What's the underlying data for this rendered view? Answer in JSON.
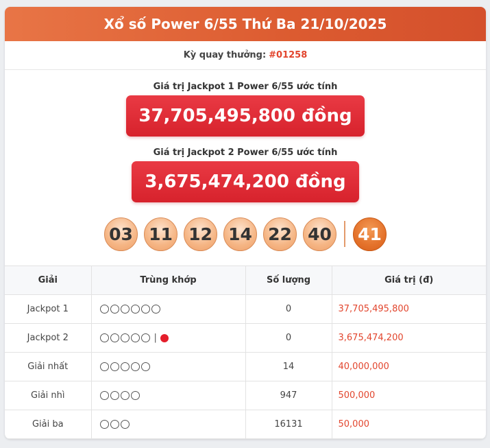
{
  "header": {
    "title": "Xổ số Power 6/55 Thứ Ba 21/10/2025"
  },
  "draw": {
    "label": "Kỳ quay thưởng:",
    "code": "#01258"
  },
  "jackpot1": {
    "label": "Giá trị Jackpot 1 Power 6/55 ước tính",
    "amount": "37,705,495,800 đồng"
  },
  "jackpot2": {
    "label": "Giá trị Jackpot 2 Power 6/55 ước tính",
    "amount": "3,675,474,200 đồng"
  },
  "numbers": [
    "03",
    "11",
    "12",
    "14",
    "22",
    "40"
  ],
  "power_number": "41",
  "colors": {
    "accent": "#dc5b30",
    "jackpot": "#e02a34",
    "value_text": "#e2452d",
    "power_ball": "#e4722b"
  },
  "table": {
    "headers": [
      "Giải",
      "Trùng khớp",
      "Số lượng",
      "Giá trị (đ)"
    ],
    "rows": [
      {
        "prize": "Jackpot 1",
        "circles": 6,
        "power": false,
        "count": "0",
        "value": "37,705,495,800"
      },
      {
        "prize": "Jackpot 2",
        "circles": 5,
        "power": true,
        "separator": "|",
        "count": "0",
        "value": "3,675,474,200"
      },
      {
        "prize": "Giải nhất",
        "circles": 5,
        "power": false,
        "count": "14",
        "value": "40,000,000"
      },
      {
        "prize": "Giải nhì",
        "circles": 4,
        "power": false,
        "count": "947",
        "value": "500,000"
      },
      {
        "prize": "Giải ba",
        "circles": 3,
        "power": false,
        "count": "16131",
        "value": "50,000"
      }
    ]
  }
}
